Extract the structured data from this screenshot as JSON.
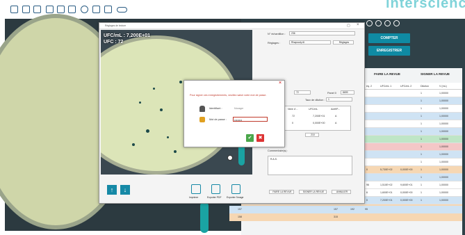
{
  "brand": "interscience",
  "toolbar": {
    "icons": [
      "add-icon",
      "folder-icon",
      "save-icon",
      "camera-icon",
      "photos-icon",
      "print-icon",
      "history-icon",
      "report-icon",
      "review-icon",
      "toggle-icon"
    ]
  },
  "main_actions": {
    "count_label": "COMPTER",
    "save_label": "ENREGISTRER"
  },
  "review_buttons": {
    "review_label": "FAIRE LA REVUE",
    "sign_label": "SIGNER LA REVUE"
  },
  "results_table": {
    "headers": [
      "éq. 2",
      "UFC/mL 1",
      "UFC/mL 2",
      "Dilution",
      "V (mL)"
    ],
    "rows": [
      {
        "color": "#ffffff",
        "c0": "",
        "c1": "",
        "c2": "",
        "c3": "1",
        "c4": "1,00000"
      },
      {
        "color": "#cfe3f4",
        "c0": "",
        "c1": "",
        "c2": "",
        "c3": "1",
        "c4": "1,00000"
      },
      {
        "color": "#ffffff",
        "c0": "",
        "c1": "",
        "c2": "",
        "c3": "1",
        "c4": "1,00000"
      },
      {
        "color": "#cfe3f4",
        "c0": "",
        "c1": "",
        "c2": "",
        "c3": "1",
        "c4": "1,00000"
      },
      {
        "color": "#ffffff",
        "c0": "",
        "c1": "",
        "c2": "",
        "c3": "1",
        "c4": "1,00000"
      },
      {
        "color": "#cfe3f4",
        "c0": "",
        "c1": "",
        "c2": "",
        "c3": "1",
        "c4": "1,00000"
      },
      {
        "color": "#bfe6c6",
        "c0": "",
        "c1": "",
        "c2": "",
        "c3": "1",
        "c4": "1,00000"
      },
      {
        "color": "#f4c7c7",
        "c0": "",
        "c1": "",
        "c2": "",
        "c3": "1",
        "c4": "1,00000"
      },
      {
        "color": "#cfe3f4",
        "c0": "",
        "c1": "",
        "c2": "",
        "c3": "1",
        "c4": "1,00000"
      },
      {
        "color": "#ffffff",
        "c0": "",
        "c1": "",
        "c2": "",
        "c3": "1",
        "c4": "1,00000"
      },
      {
        "color": "#f6d7b3",
        "c0": "0",
        "c1": "5,730E+02",
        "c2": "0,000E+00",
        "c3": "1",
        "c4": "1,00000"
      },
      {
        "color": "#cfe3f4",
        "c0": "",
        "c1": "",
        "c2": "",
        "c3": "1",
        "c4": "1,00000"
      },
      {
        "color": "#ffffff",
        "c0": "96",
        "c1": "1,510E+02",
        "c2": "9,600E+01",
        "c3": "1",
        "c4": "1,00000"
      },
      {
        "color": "#ffffff",
        "c0": "6",
        "c1": "1,600E+01",
        "c2": "0,000E+00",
        "c3": "1",
        "c4": "1,00000"
      },
      {
        "color": "#cfe3f4",
        "c0": "0",
        "c1": "7,200E+01",
        "c2": "0,000E+00",
        "c3": "1",
        "c4": "1,00000"
      },
      {
        "color": "#f6d7b3",
        "c0": "95",
        "c1": "1,520E+02",
        "c2": "9,500E+01",
        "c3": "1",
        "c4": "1,00000"
      }
    ],
    "bottom_rows": [
      {
        "color": "#cfe3f4",
        "id": "157",
        "v1": "157",
        "v2": "192",
        "v3": "95"
      },
      {
        "color": "#f6d7b3",
        "id": "158",
        "v1": "315",
        "v2": "",
        "v3": ""
      }
    ]
  },
  "reading_window": {
    "title": "Réglages de lecture",
    "overlay_line1": "UFC/mL : 7,200E+01",
    "overlay_line2": "UFC : 72",
    "close_glyph": "×",
    "bottom_buttons": [
      "Imprimer",
      "Exporter PDF",
      "Exporter l'image"
    ],
    "sample_label": "N° échantillon :",
    "sample_value": "236",
    "settings_label": "Réglages :",
    "settings_value": "Rhapsody AI",
    "settings_button": "Réglages",
    "count_field_value": "72",
    "panel_label": "Panel 0",
    "panel_value": "8699",
    "ufc_value": "7,200E+01",
    "dilution_label": "Taux de dilution :",
    "dilution_value": "1",
    "grid_headers": [
      "tome",
      "Nbre d'...",
      "UFC/mL",
      "Actif/P..."
    ],
    "grid_rows": [
      {
        "c0": "A",
        "c1": "72",
        "c2": "7,200E+01",
        "c3": "A"
      },
      {
        "c0": "N",
        "c1": "0",
        "c2": "0,000E+00",
        "c3": "A"
      }
    ],
    "modifications_label": "modifications :",
    "modifications_value": "210",
    "comments_label": "Commentaire(s) :",
    "comments_value": "R.A.S.",
    "footer_buttons": [
      "FAIRE LA REVUE",
      "SIGNER LA REVUE",
      "ANNULER"
    ]
  },
  "password_dialog": {
    "message": "Pour signer ces enregistrements, veuillez saisir votre mot de passe.",
    "id_label": "Identifiant :",
    "id_value": "Manager",
    "pwd_label": "Mot de passe :",
    "pwd_value": "••••••••",
    "close_glyph": "×",
    "ok_glyph": "✔",
    "cancel_glyph": "✖"
  }
}
